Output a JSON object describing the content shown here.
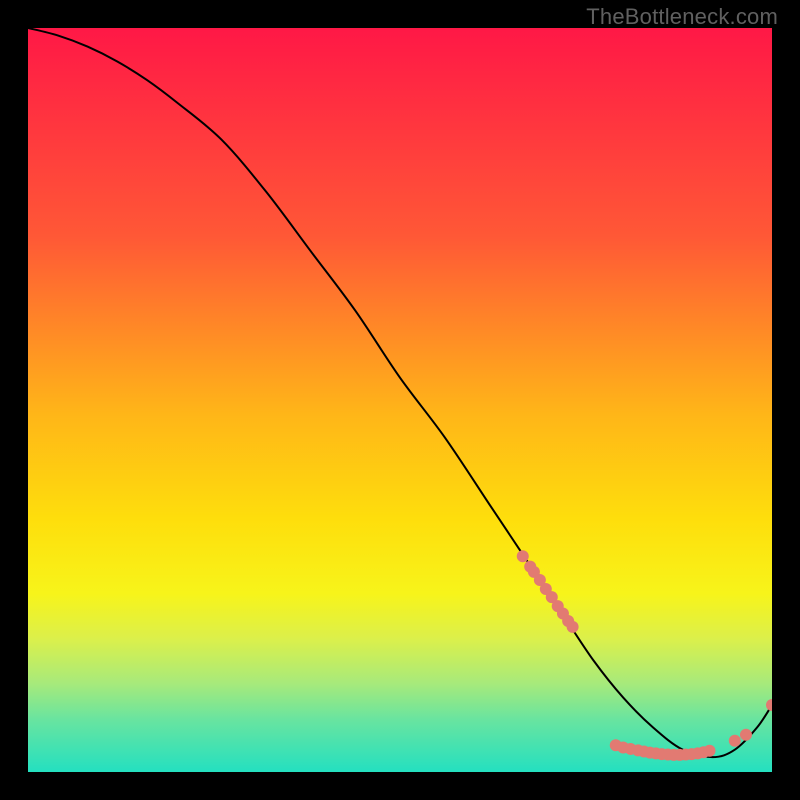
{
  "watermark": "TheBottleneck.com",
  "chart_data": {
    "type": "line",
    "title": "",
    "xlabel": "",
    "ylabel": "",
    "xlim": [
      0,
      100
    ],
    "ylim": [
      0,
      100
    ],
    "grid": false,
    "background_gradient": {
      "stops": [
        {
          "offset": 0,
          "color": "#ff1846"
        },
        {
          "offset": 28,
          "color": "#ff5836"
        },
        {
          "offset": 52,
          "color": "#ffb618"
        },
        {
          "offset": 66,
          "color": "#fede0c"
        },
        {
          "offset": 76,
          "color": "#f7f41a"
        },
        {
          "offset": 82,
          "color": "#dcf04a"
        },
        {
          "offset": 88,
          "color": "#a8ea7a"
        },
        {
          "offset": 93,
          "color": "#68e4a0"
        },
        {
          "offset": 100,
          "color": "#24e0c0"
        }
      ]
    },
    "series": [
      {
        "name": "bottleneck-curve",
        "type": "line",
        "color": "#000000",
        "x": [
          0,
          4,
          8,
          12,
          16,
          20,
          26,
          32,
          38,
          44,
          50,
          56,
          62,
          66,
          70,
          72,
          76,
          80,
          84,
          88,
          92,
          95,
          98,
          100
        ],
        "y": [
          100,
          99,
          97.5,
          95.5,
          93,
          90,
          85,
          78,
          70,
          62,
          53,
          45,
          36,
          30,
          24,
          21,
          15,
          10,
          6,
          3,
          2,
          3,
          6,
          9
        ]
      },
      {
        "name": "markers-upper-run",
        "type": "scatter",
        "color": "#e27a72",
        "marker_radius": 6,
        "x": [
          66.5,
          67.5,
          68.0,
          68.8,
          69.6,
          70.4,
          71.2,
          71.9,
          72.6,
          73.2
        ],
        "y": [
          29.0,
          27.6,
          26.9,
          25.8,
          24.6,
          23.5,
          22.3,
          21.3,
          20.3,
          19.5
        ]
      },
      {
        "name": "markers-valley",
        "type": "scatter",
        "color": "#e27a72",
        "marker_radius": 6,
        "x": [
          79.0,
          80.0,
          81.0,
          82.0,
          82.8,
          83.6,
          84.4,
          85.2,
          86.0,
          86.8,
          87.6,
          88.4,
          89.2,
          90.0,
          90.8,
          91.6
        ],
        "y": [
          3.6,
          3.3,
          3.1,
          2.9,
          2.75,
          2.6,
          2.5,
          2.4,
          2.35,
          2.3,
          2.3,
          2.35,
          2.4,
          2.5,
          2.65,
          2.85
        ]
      },
      {
        "name": "markers-tail",
        "type": "scatter",
        "color": "#e27a72",
        "marker_radius": 6,
        "x": [
          95.0,
          96.5,
          100.0
        ],
        "y": [
          4.2,
          5.0,
          9.0
        ]
      }
    ]
  }
}
